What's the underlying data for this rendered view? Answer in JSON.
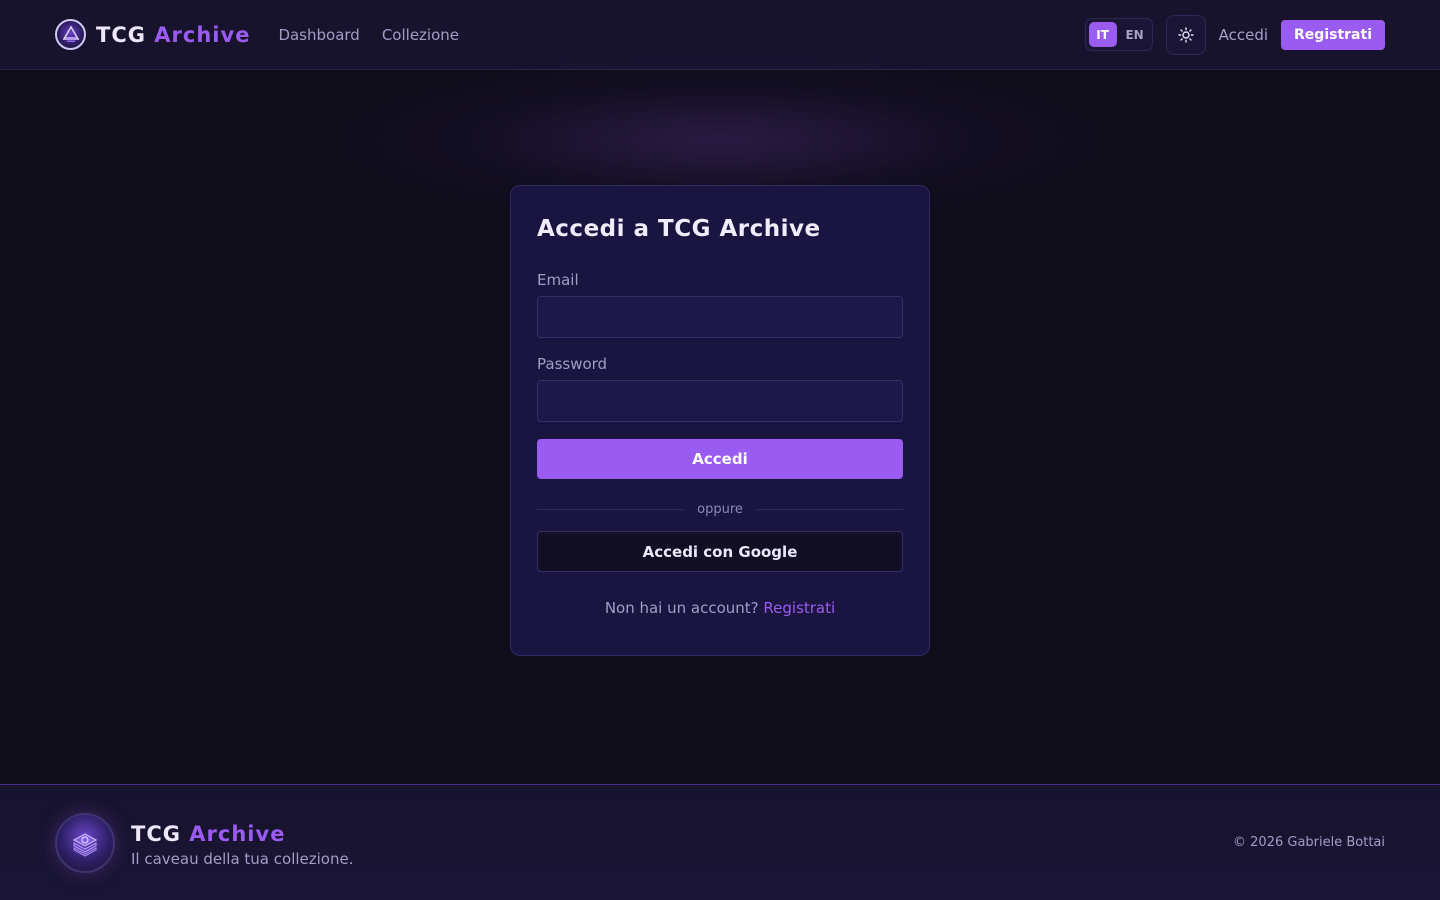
{
  "header": {
    "brand": {
      "word1": "TCG",
      "word2": "Archive"
    },
    "nav": [
      {
        "label": "Dashboard"
      },
      {
        "label": "Collezione"
      }
    ],
    "languages": [
      {
        "code": "IT",
        "active": true
      },
      {
        "code": "EN",
        "active": false
      }
    ],
    "theme_icon": "sun-icon",
    "login_label": "Accedi",
    "register_label": "Registrati"
  },
  "login_card": {
    "title": "Accedi a TCG Archive",
    "email_label": "Email",
    "email_value": "",
    "password_label": "Password",
    "password_value": "",
    "submit_label": "Accedi",
    "divider_text": "oppure",
    "google_label": "Accedi con Google",
    "signup_prompt": "Non hai un account?",
    "signup_link": "Registrati"
  },
  "footer": {
    "brand": {
      "word1": "TCG",
      "word2": "Archive"
    },
    "tagline": "Il caveau della tua collezione.",
    "copyright": "© 2026 Gabriele Bottai"
  },
  "colors": {
    "accent": "#9a5cf0",
    "background": "#0f0d1a",
    "card": "#1a1540",
    "header": "#17132d"
  }
}
